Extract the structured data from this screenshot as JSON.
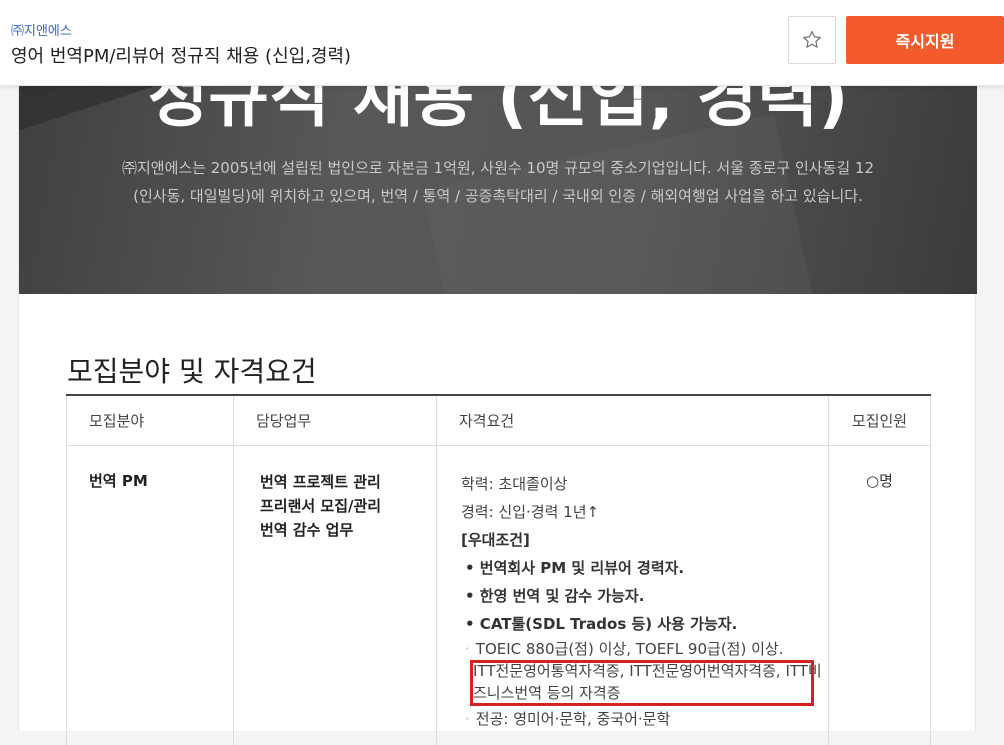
{
  "header": {
    "company": "㈜지앤에스",
    "job_title": "영어 번역PM/리뷰어 정규직 채용 (신입,경력)",
    "apply_label": "즉시지원",
    "star_icon": "star-outline-icon"
  },
  "banner": {
    "headline": "정규직 채용 (신입, 경력)",
    "desc_line1": "㈜지앤에스는 2005년에 설립된 법인으로 자본금 1억원, 사원수 10명 규모의 중소기업입니다. 서울 종로구 인사동길 12",
    "desc_line2": "(인사동, 대일빌딩)에 위치하고 있으며, 번역 / 통역 / 공증촉탁대리 / 국내외 인증 / 해외여행업 사업을 하고 있습니다."
  },
  "section": {
    "title": "모집분야 및 자격요건"
  },
  "table": {
    "headers": [
      "모집분야",
      "담당업무",
      "자격요건",
      "모집인원"
    ],
    "row": {
      "field": "번역 PM",
      "duties": [
        "번역 프로젝트 관리",
        "프리랜서 모집/관리",
        "번역 감수 업무"
      ],
      "req_education": "학력: 초대졸이상",
      "req_experience": "경력: 신입·경력 1년↑",
      "preferred_title": "[우대조건]",
      "preferred": [
        "• 번역회사 PM 및 리뷰어 경력자.",
        "• 한영 번역 및 감수 가능자.",
        "• CAT툴(SDL Trados 등) 사용 가능자."
      ],
      "toeic": "TOEIC 880급(점) 이상, TOEFL 90급(점) 이상.",
      "cert_line1": "ITT전문영어통역자격증, ITT전문영어번역자격증, ITT비",
      "cert_line2": "즈니스번역 등의 자격증",
      "major": "전공: 영미어·문학, 중국어·문학",
      "count": "○명"
    }
  },
  "colors": {
    "apply": "#f45b2c",
    "company_link": "#3366cc",
    "highlight_border": "#d42121"
  }
}
